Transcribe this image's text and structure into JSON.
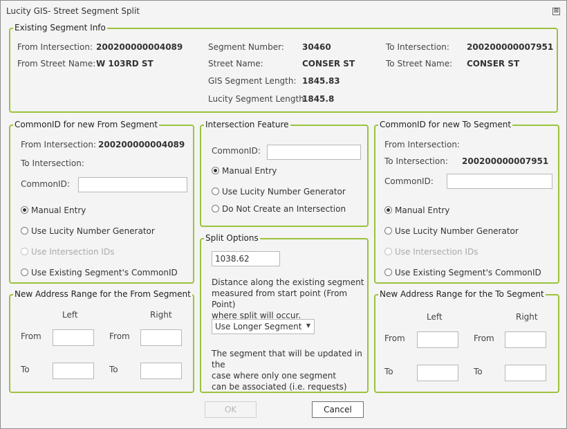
{
  "window": {
    "title": "Lucity GIS- Street Segment Split",
    "close_glyph": "⊠"
  },
  "existing": {
    "legend": "Existing Segment Info",
    "from_intersection_label": "From Intersection:",
    "from_intersection_value": "200200000004089",
    "from_street_label": "From Street Name:",
    "from_street_value": "W 103RD ST",
    "segment_number_label": "Segment Number:",
    "segment_number_value": "30460",
    "street_name_label": "Street Name:",
    "street_name_value": "CONSER ST",
    "gis_length_label": "GIS Segment Length:",
    "gis_length_value": "1845.83",
    "lucity_length_label": "Lucity Segment Length:",
    "lucity_length_value": "1845.8",
    "to_intersection_label": "To Intersection:",
    "to_intersection_value": "200200000007951",
    "to_street_label": "To Street Name:",
    "to_street_value": "CONSER ST"
  },
  "from_common": {
    "legend": "CommonID for new From Segment",
    "from_intersection_label": "From Intersection:",
    "from_intersection_value": "200200000004089",
    "to_intersection_label": "To Intersection:",
    "commonid_label": "CommonID:",
    "commonid_value": "",
    "opt_manual": "Manual Entry",
    "opt_generator": "Use Lucity Number Generator",
    "opt_intersection_ids": "Use Intersection IDs",
    "opt_existing": "Use Existing Segment's CommonID"
  },
  "intersection": {
    "legend": "Intersection Feature",
    "commonid_label": "CommonID:",
    "commonid_value": "",
    "opt_manual": "Manual Entry",
    "opt_generator": "Use Lucity Number Generator",
    "opt_none": "Do Not Create an Intersection"
  },
  "to_common": {
    "legend": "CommonID for new To Segment",
    "from_intersection_label": "From Intersection:",
    "to_intersection_label": "To Intersection:",
    "to_intersection_value": "200200000007951",
    "commonid_label": "CommonID:",
    "commonid_value": "",
    "opt_manual": "Manual Entry",
    "opt_generator": "Use Lucity Number Generator",
    "opt_intersection_ids": "Use Intersection IDs",
    "opt_existing": "Use Existing Segment's CommonID"
  },
  "split": {
    "legend": "Split Options",
    "distance_value": "1038.62",
    "distance_desc_1": "Distance along the existing segment",
    "distance_desc_2": "measured from start point (From Point)",
    "distance_desc_3": "where split will occur.",
    "segment_select_value": "Use Longer Segment",
    "select_arrow": "▼",
    "segment_desc_1": "The segment that will be updated in the",
    "segment_desc_2": "case where only one segment",
    "segment_desc_3": "can be associated (i.e. requests)"
  },
  "from_address": {
    "legend": "New Address Range for the From Segment",
    "left_header": "Left",
    "right_header": "Right",
    "from_label_left": "From",
    "from_label_right": "From",
    "to_label_left": "To",
    "to_label_right": "To",
    "left_from": "",
    "right_from": "",
    "left_to": "",
    "right_to": ""
  },
  "to_address": {
    "legend": "New Address Range for the To Segment",
    "left_header": "Left",
    "right_header": "Right",
    "from_label_left": "From",
    "from_label_right": "From",
    "to_label_left": "To",
    "to_label_right": "To",
    "left_from": "",
    "right_from": "",
    "left_to": "",
    "right_to": ""
  },
  "buttons": {
    "ok": "OK",
    "cancel": "Cancel"
  }
}
